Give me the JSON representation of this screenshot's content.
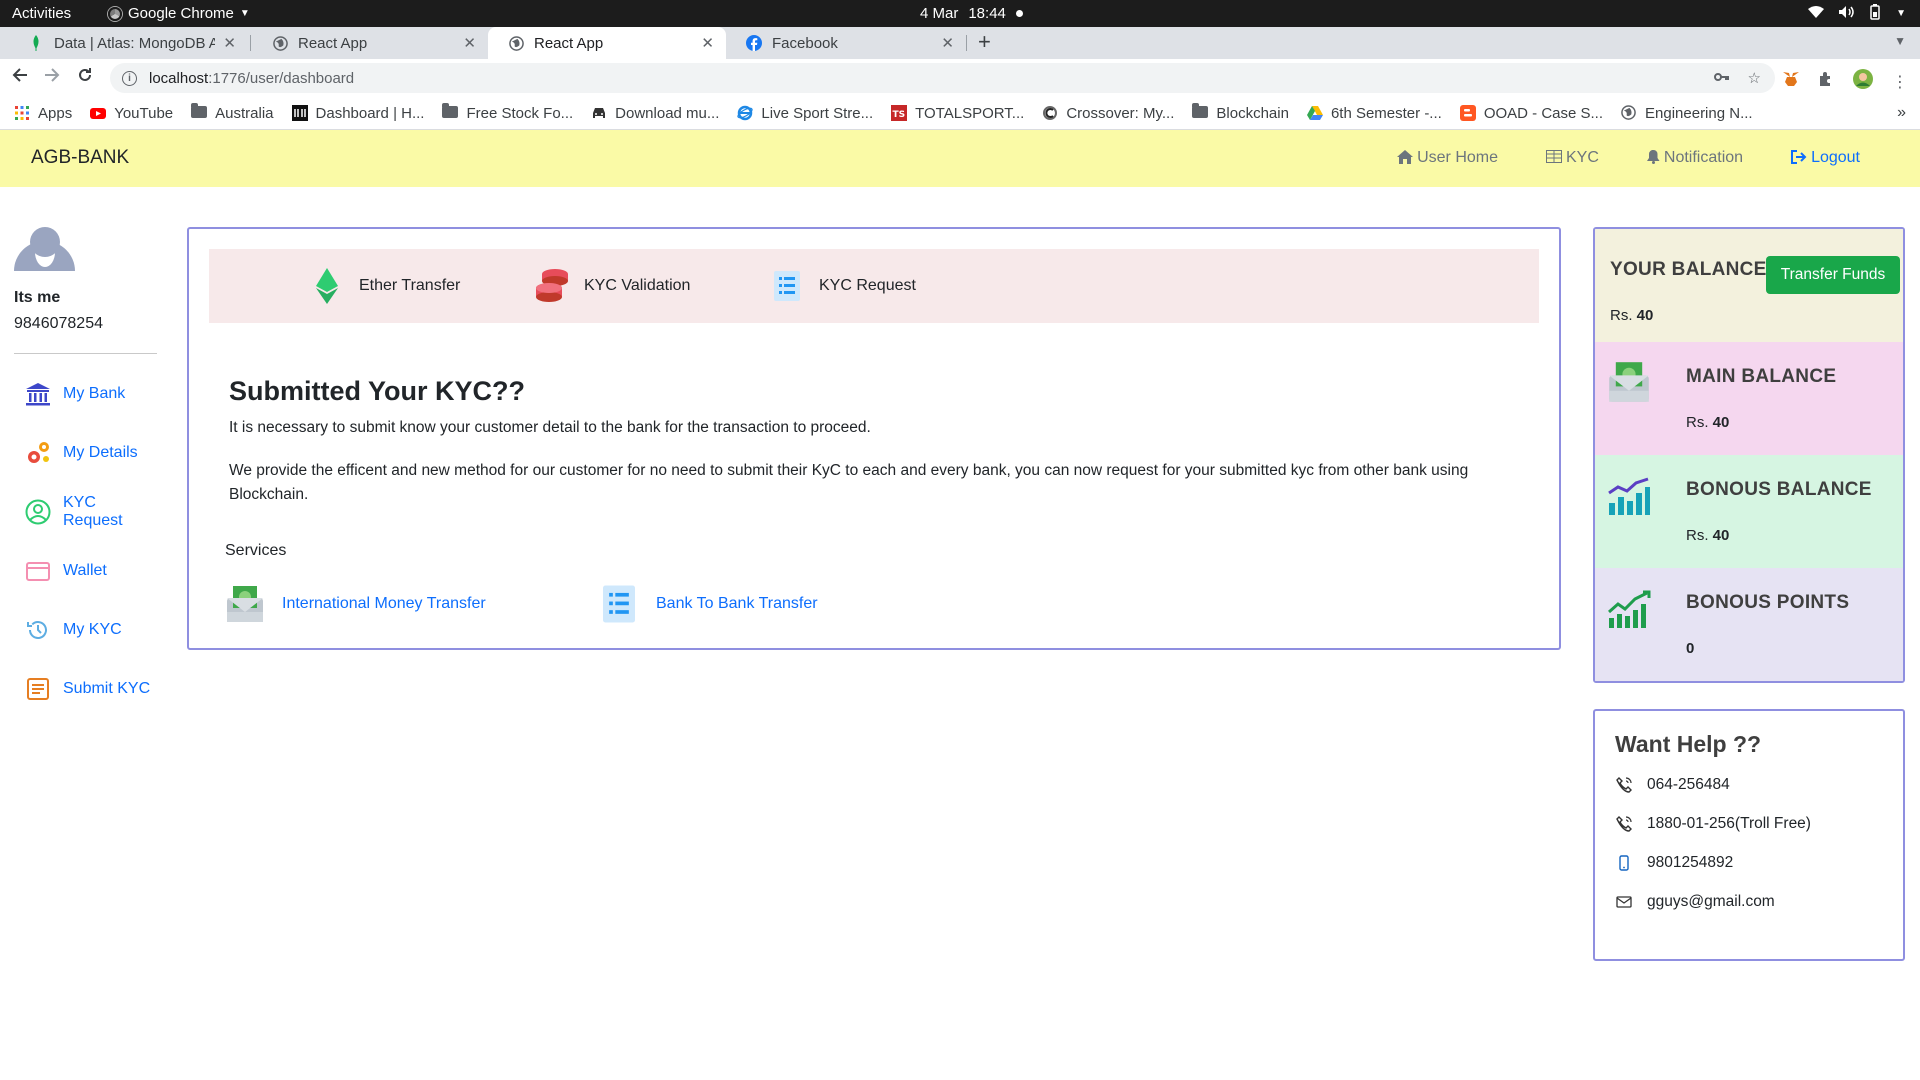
{
  "os_bar": {
    "activities": "Activities",
    "app_name": "Google Chrome",
    "date": "4 Mar",
    "time": "18:44"
  },
  "browser": {
    "tabs": [
      {
        "title": "Data | Atlas: MongoDB At",
        "icon": "mongodb-leaf-icon",
        "active": false
      },
      {
        "title": "React App",
        "icon": "globe-icon",
        "active": false
      },
      {
        "title": "React App",
        "icon": "globe-icon",
        "active": true
      },
      {
        "title": "Facebook",
        "icon": "facebook-icon",
        "active": false
      }
    ],
    "url_host": "localhost",
    "url_path": ":1776/user/dashboard",
    "bookmarks": [
      {
        "label": "Apps",
        "icon": "apps-grid-icon"
      },
      {
        "label": "YouTube",
        "icon": "youtube-icon"
      },
      {
        "label": "Australia",
        "icon": "folder-icon"
      },
      {
        "label": "Dashboard | H...",
        "icon": "dashboard-favicon"
      },
      {
        "label": "Free Stock Fo...",
        "icon": "folder-icon"
      },
      {
        "label": "Download mu...",
        "icon": "car-icon"
      },
      {
        "label": "Live Sport Stre...",
        "icon": "ie-icon"
      },
      {
        "label": "TOTALSPORT...",
        "icon": "ts-icon"
      },
      {
        "label": "Crossover: My...",
        "icon": "crossover-icon"
      },
      {
        "label": "Blockchain",
        "icon": "folder-icon"
      },
      {
        "label": "6th Semester -...",
        "icon": "google-drive-icon"
      },
      {
        "label": "OOAD - Case S...",
        "icon": "blogger-icon"
      },
      {
        "label": "Engineering N...",
        "icon": "globe-icon"
      }
    ]
  },
  "navbar": {
    "brand": "AGB-BANK",
    "links": [
      {
        "label": "User Home",
        "icon": "home-icon"
      },
      {
        "label": "KYC",
        "icon": "table-icon"
      },
      {
        "label": "Notification",
        "icon": "bell-icon"
      },
      {
        "label": "Logout",
        "icon": "logout-icon"
      }
    ]
  },
  "sidebar": {
    "user_name": "Its me",
    "user_phone": "9846078254",
    "items": [
      {
        "label": "My Bank",
        "icon": "bank-icon"
      },
      {
        "label": "My Details",
        "icon": "gears-icon"
      },
      {
        "label": "KYC Request",
        "icon": "user-circle-icon"
      },
      {
        "label": "Wallet",
        "icon": "wallet-icon"
      },
      {
        "label": "My KYC",
        "icon": "history-icon"
      },
      {
        "label": "Submit KYC",
        "icon": "document-icon"
      }
    ]
  },
  "main": {
    "quick_actions": [
      {
        "label": "Ether Transfer",
        "icon": "ethereum-icon"
      },
      {
        "label": "KYC Validation",
        "icon": "database-icon"
      },
      {
        "label": "KYC Request",
        "icon": "list-icon"
      }
    ],
    "title": "Submitted Your KYC??",
    "paragraph1": "It is necessary to submit know your customer detail to the bank for the transaction to proceed.",
    "paragraph2": "We provide the efficent and new method for our customer for no need to submit their KyC to each and every bank, you can now request for your submitted kyc from other bank using Blockchain.",
    "services_label": "Services",
    "services": [
      {
        "label": "International Money Transfer",
        "icon": "money-envelope-icon"
      },
      {
        "label": "Bank To Bank Transfer",
        "icon": "list-icon"
      }
    ]
  },
  "balance": {
    "your_balance_title": "YOUR BALANCE",
    "transfer_button": "Transfer Funds",
    "your_balance_prefix": "Rs.",
    "your_balance_value": "40",
    "main_balance_title": "MAIN BALANCE",
    "main_balance_prefix": "Rs.",
    "main_balance_value": "40",
    "bonus_balance_title": "BONOUS BALANCE",
    "bonus_balance_prefix": "Rs.",
    "bonus_balance_value": "40",
    "bonus_points_title": "BONOUS POINTS",
    "bonus_points_value": "0"
  },
  "help": {
    "title": "Want Help ??",
    "contacts": [
      {
        "value": "064-256484",
        "icon": "phone-icon"
      },
      {
        "value": "1880-01-256(Troll Free)",
        "icon": "phone-icon"
      },
      {
        "value": "9801254892",
        "icon": "mobile-icon"
      },
      {
        "value": "gguys@gmail.com",
        "icon": "envelope-icon"
      }
    ]
  },
  "colors": {
    "navbar_bg": "#fafaa6",
    "link_blue": "#0d6efd",
    "card_border": "#8f8fe0",
    "transfer_button": "#19a74a",
    "your_balance_bg": "#f3f1dd",
    "main_balance_bg": "#f5d7ef",
    "bonus_balance_bg": "#d6f5e2",
    "bonus_points_bg": "#e6e3f3",
    "quickbar_bg": "#f7e9ea"
  }
}
